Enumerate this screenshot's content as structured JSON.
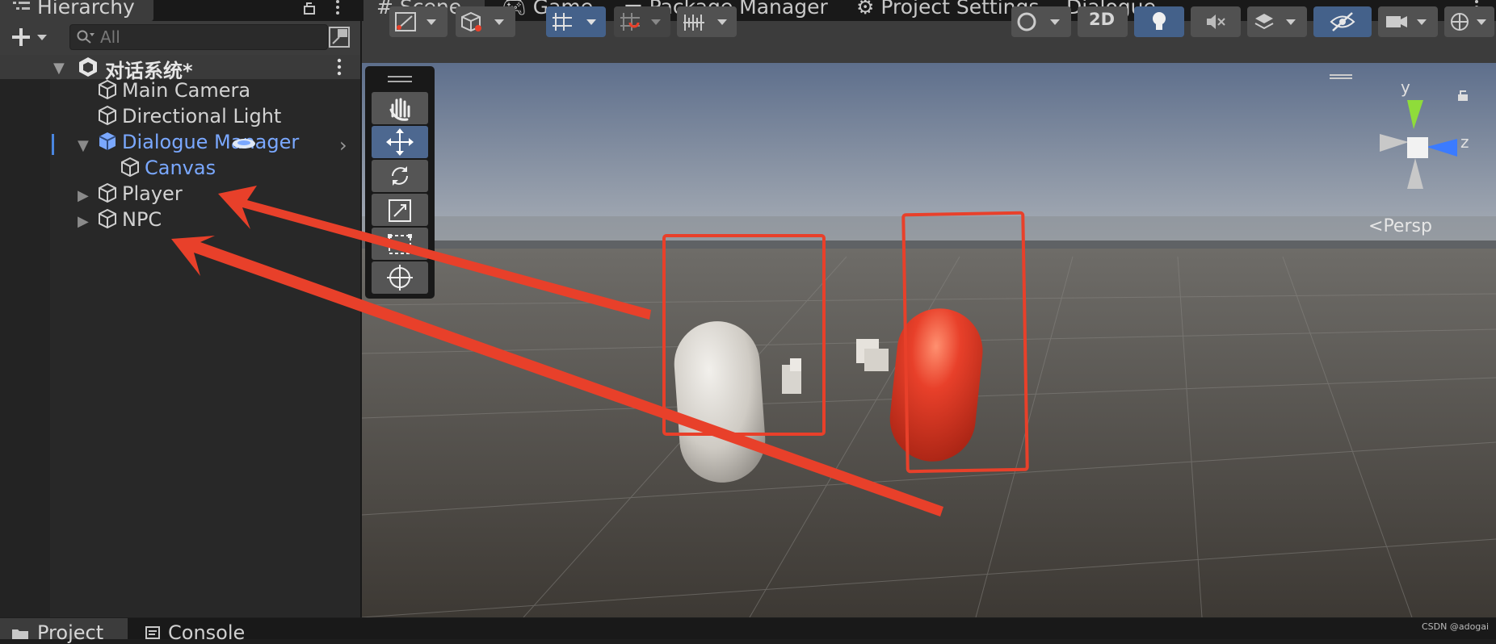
{
  "hierarchy": {
    "tab_label": "Hierarchy",
    "search_placeholder": "All",
    "scene_name": "对话系统*",
    "items": [
      {
        "label": "Main Camera"
      },
      {
        "label": "Directional Light"
      },
      {
        "label": "Dialogue Manager"
      },
      {
        "label": "Canvas"
      },
      {
        "label": "Player"
      },
      {
        "label": "NPC"
      }
    ]
  },
  "tabs": {
    "scene": "Scene",
    "game": "Game",
    "package_manager": "Package Manager",
    "project_settings": "Project Settings",
    "dialogue": "Dialogue"
  },
  "scene_toolbar": {
    "mode_2d": "2D"
  },
  "gizmo": {
    "y": "y",
    "z": "z",
    "projection": "Persp"
  },
  "bottom_tabs": {
    "project": "Project",
    "console": "Console"
  },
  "watermark": "CSDN @adogai",
  "colors": {
    "panel": "#282828",
    "selected_text": "#7aa8ff",
    "annotation": "#e8402a",
    "npc": "#e0432c"
  }
}
